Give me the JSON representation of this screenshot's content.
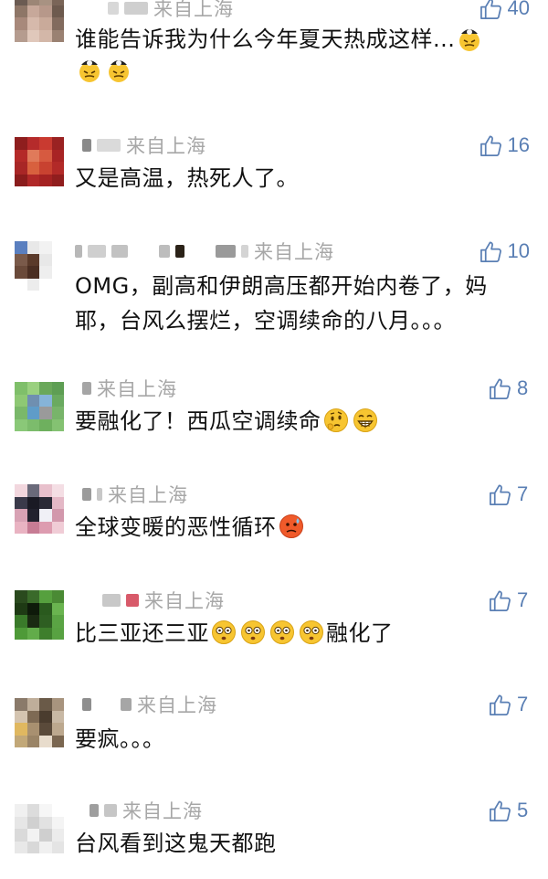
{
  "comments": [
    {
      "location": "来自上海",
      "likes": "40",
      "text_line1": "谁能告诉我为什么今年夏天热成这样...",
      "emoji_line1": [
        "sweat-helmet-emoji"
      ],
      "emoji_line2": [
        "sweat-helmet-emoji",
        "sweat-helmet-emoji"
      ]
    },
    {
      "location": "来自上海",
      "likes": "16",
      "text": "又是高温，热死人了。"
    },
    {
      "location": "来自上海",
      "likes": "10",
      "text_line1": "OMG，副高和伊朗高压都开始内卷了，妈",
      "text_line2": "耶，台风么摆烂，空调续命的八月。。。"
    },
    {
      "location": "来自上海",
      "likes": "8",
      "text": "要融化了！西瓜空调续命",
      "emoji_after": [
        "thinking-face-emoji",
        "grinning-face-emoji"
      ]
    },
    {
      "location": "来自上海",
      "likes": "7",
      "text": "全球变暖的恶性循环",
      "emoji_after": [
        "hot-face-emoji"
      ]
    },
    {
      "location": "来自上海",
      "likes": "7",
      "text_before": "比三亚还三亚",
      "emoji_middle": [
        "shocked-face-emoji",
        "shocked-face-emoji",
        "shocked-face-emoji",
        "shocked-face-emoji"
      ],
      "text_after": "融化了"
    },
    {
      "location": "来自上海",
      "likes": "7",
      "text": "要疯。。。"
    },
    {
      "location": "来自上海",
      "likes": "5",
      "text": "台风看到这鬼天都跑"
    }
  ],
  "colors": {
    "like_blue": "#5a7fb4",
    "meta_gray": "#a7a7a7",
    "text": "#111111"
  }
}
